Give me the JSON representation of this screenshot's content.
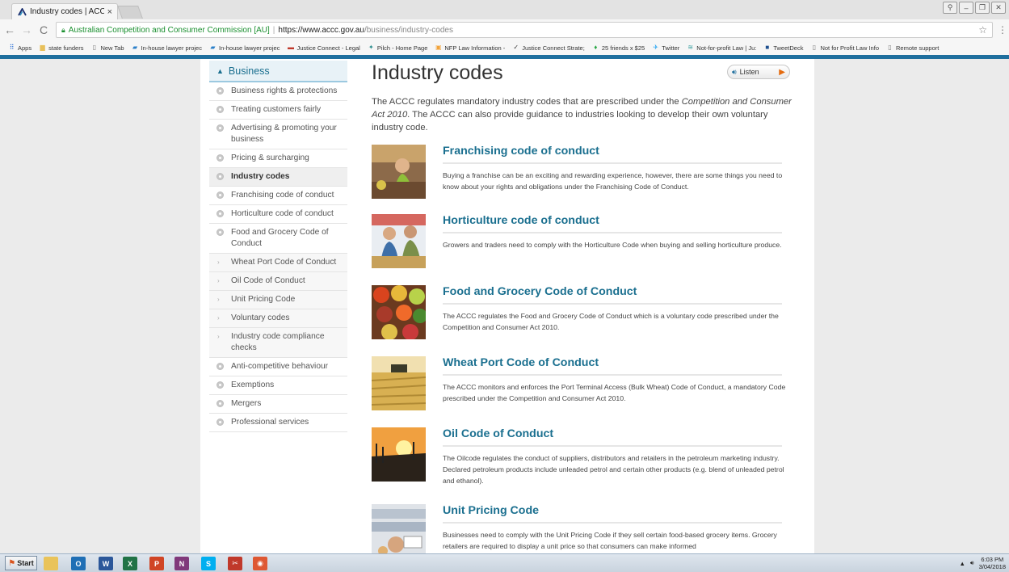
{
  "browser": {
    "tab_title": "Industry codes | ACCC",
    "tab_close": "×",
    "address": {
      "org": "Australian Competition and Consumer Commission [AU]",
      "separator": "|",
      "host": "https://www.accc.gov.au",
      "path": "/business/industry-codes"
    },
    "bookmarks": [
      {
        "label": "Apps",
        "icon": "apps-grid-icon"
      },
      {
        "label": "state funders",
        "icon": "folder-icon"
      },
      {
        "label": "New Tab",
        "icon": "page-icon"
      },
      {
        "label": "In-house lawyer projec",
        "icon": "bookmark-icon"
      },
      {
        "label": "In-house lawyer projec",
        "icon": "bookmark-icon"
      },
      {
        "label": "Justice Connect - Legal",
        "icon": "justice-connect-icon"
      },
      {
        "label": "Pilch - Home Page",
        "icon": "pilch-icon"
      },
      {
        "label": "NFP Law Information -",
        "icon": "nfp-law-icon"
      },
      {
        "label": "Justice Connect Strate;",
        "icon": "checkmark-icon"
      },
      {
        "label": "25 friends x $25",
        "icon": "friends-icon"
      },
      {
        "label": "Twitter",
        "icon": "twitter-icon"
      },
      {
        "label": "Not-for-profit Law | Ju:",
        "icon": "nfp-icon"
      },
      {
        "label": "TweetDeck",
        "icon": "tweetdeck-icon"
      },
      {
        "label": "Not for Profit Law Info",
        "icon": "page-icon"
      },
      {
        "label": "Remote support",
        "icon": "page-icon"
      }
    ]
  },
  "sidebar": {
    "heading": "Business",
    "items": [
      {
        "label": "Business rights & protections",
        "kind": "bullet"
      },
      {
        "label": "Treating customers fairly",
        "kind": "bullet"
      },
      {
        "label": "Advertising & promoting your business",
        "kind": "bullet"
      },
      {
        "label": "Pricing & surcharging",
        "kind": "bullet"
      },
      {
        "label": "Industry codes",
        "kind": "active"
      },
      {
        "label": "Franchising code of conduct",
        "kind": "bullet"
      },
      {
        "label": "Horticulture code of conduct",
        "kind": "bullet"
      },
      {
        "label": "Food and Grocery Code of Conduct",
        "kind": "bullet"
      },
      {
        "label": "Wheat Port Code of Conduct",
        "kind": "arrow"
      },
      {
        "label": "Oil Code of Conduct",
        "kind": "arrow"
      },
      {
        "label": "Unit Pricing Code",
        "kind": "arrow"
      },
      {
        "label": "Voluntary codes",
        "kind": "arrow"
      },
      {
        "label": "Industry code compliance checks",
        "kind": "arrow"
      },
      {
        "label": "Anti-competitive behaviour",
        "kind": "bullet"
      },
      {
        "label": "Exemptions",
        "kind": "bullet"
      },
      {
        "label": "Mergers",
        "kind": "bullet"
      },
      {
        "label": "Professional services",
        "kind": "bullet"
      }
    ]
  },
  "main": {
    "title": "Industry codes",
    "listen_label": "Listen",
    "intro": {
      "part1": "The ACCC regulates mandatory industry codes that are prescribed under the ",
      "act": "Competition and Consumer Act 2010",
      "part2": ". The ACCC can also provide guidance to industries looking to develop their own voluntary industry code."
    },
    "codes": [
      {
        "title": "Franchising code of conduct",
        "text": "Buying a franchise can be an exciting and rewarding experience, however, there are some things you need to know about your rights and obligations under the Franchising Code of Conduct."
      },
      {
        "title": "Horticulture code of conduct",
        "text": "Growers and traders need to comply with the Horticulture Code when buying and selling horticulture produce."
      },
      {
        "title": "Food and Grocery Code of Conduct",
        "text": "The ACCC regulates the Food and Grocery Code of Conduct which is a voluntary code prescribed under the Competition and Consumer Act 2010."
      },
      {
        "title": "Wheat Port Code of Conduct",
        "text": "The ACCC monitors and enforces the Port Terminal Access (Bulk Wheat) Code of Conduct, a mandatory Code prescribed under the Competition and Consumer Act 2010."
      },
      {
        "title": "Oil Code of Conduct",
        "text": "The Oilcode regulates the conduct of suppliers, distributors and retailers in the petroleum marketing industry. Declared petroleum products include unleaded petrol and certain other products (e.g. blend of unleaded petrol and ethanol)."
      },
      {
        "title": "Unit Pricing Code",
        "text": "Businesses need to comply with the Unit Pricing Code if they sell certain food-based grocery items. Grocery retailers are required to display a unit price so that consumers can make informed"
      }
    ]
  },
  "taskbar": {
    "start_label": "Start",
    "apps": [
      {
        "name": "file-explorer-icon",
        "letter": "",
        "color": "#e9c35a"
      },
      {
        "name": "outlook-icon",
        "letter": "O",
        "color": "#1f6fb5"
      },
      {
        "name": "word-icon",
        "letter": "W",
        "color": "#2b579a"
      },
      {
        "name": "excel-icon",
        "letter": "X",
        "color": "#217346"
      },
      {
        "name": "powerpoint-icon",
        "letter": "P",
        "color": "#d04525"
      },
      {
        "name": "onenote-icon",
        "letter": "N",
        "color": "#80397b"
      },
      {
        "name": "skype-icon",
        "letter": "S",
        "color": "#00aff0"
      },
      {
        "name": "snipping-tool-icon",
        "letter": "✂",
        "color": "#c0392b"
      },
      {
        "name": "chrome-icon",
        "letter": "◉",
        "color": "#de5833"
      }
    ],
    "time": "6:03 PM",
    "date": "3/04/2018"
  },
  "colors": {
    "accent": "#1a6f8f",
    "blue_bar": "#1f6f9e",
    "page_bg": "#ebebeb"
  }
}
